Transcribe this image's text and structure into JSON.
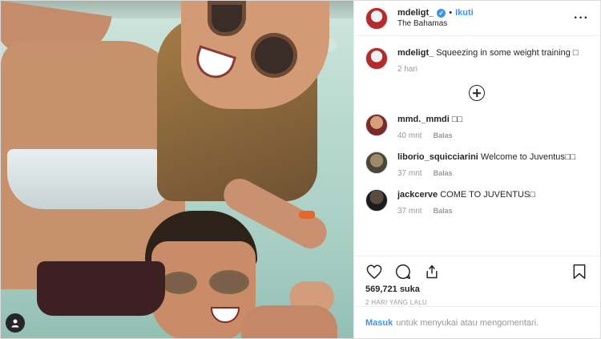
{
  "post": {
    "username": "mdeligt_",
    "verified_glyph": "✓",
    "separator": "•",
    "follow_label": "Ikuti",
    "location": "The Bahamas",
    "more_glyph": "···",
    "photo_alt": "Selfie in the sea",
    "photo_button_icon": "user-tag-icon"
  },
  "caption": {
    "username": "mdeligt_",
    "text": "Squeezing in some weight training □",
    "age": "2 hari"
  },
  "comments": [
    {
      "username": "mmd._mmdi",
      "text": "□□",
      "age": "40 mnt",
      "reply": "Balas",
      "avatar": "face"
    },
    {
      "username": "liborio_squicciarini",
      "text": "Welcome to Juventus□□",
      "age": "37 mnt",
      "reply": "Balas",
      "avatar": "olive"
    },
    {
      "username": "jackcerve",
      "text": "COME TO JUVENTUS□",
      "age": "37 mnt",
      "reply": "Balas",
      "avatar": "dark"
    }
  ],
  "actions": {
    "like_icon": "heart-icon",
    "comment_icon": "comment-icon",
    "share_icon": "share-icon",
    "save_icon": "bookmark-icon",
    "likes": "569,721 suka",
    "time_ago": "2 HARI YANG LALU"
  },
  "login": {
    "link": "Masuk",
    "text": "untuk menyukai atau mengomentari."
  },
  "colors": {
    "accent": "#3897f0",
    "text": "#262626",
    "muted": "#999999",
    "border": "#efefef"
  }
}
